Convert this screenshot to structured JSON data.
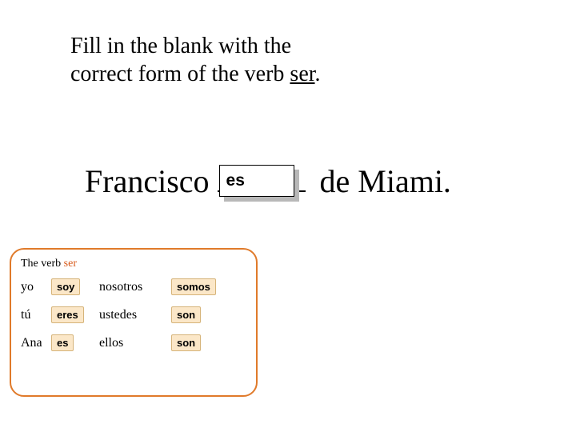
{
  "instruction": {
    "line1": "Fill in the blank with the",
    "line2_pre": "correct form of the verb ",
    "line2_verb": "ser",
    "line2_post": "."
  },
  "sentence": {
    "subject": "Francisco ",
    "answer": "es",
    "rest": " de Miami."
  },
  "chart": {
    "title_pre": "The verb ",
    "title_verb": "ser",
    "rows": [
      {
        "p1": "yo",
        "f1": "soy",
        "p2": "nosotros",
        "f2": "somos"
      },
      {
        "p1": "tú",
        "f1": "eres",
        "p2": "ustedes",
        "f2": "son"
      },
      {
        "p1": "Ana",
        "f1": "es",
        "p2": "ellos",
        "f2": "son"
      }
    ]
  }
}
